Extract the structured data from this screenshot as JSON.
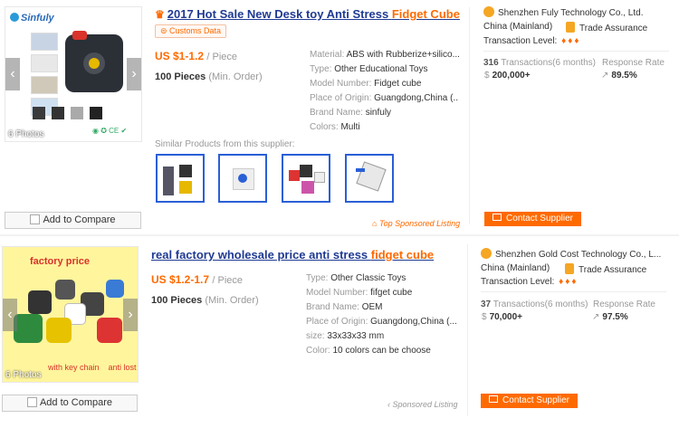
{
  "listings": [
    {
      "image_logo": "Sinfuly",
      "photo_count": "6 Photos",
      "title_prefix": "2017 Hot Sale New Desk toy Anti Stress ",
      "title_highlight": "Fidget Cube",
      "customs_badge": "Customs Data",
      "price": "US $1-1.2",
      "price_unit": "/ Piece",
      "moq": "100 Pieces",
      "moq_sub": "(Min. Order)",
      "attributes": [
        {
          "key": "Material:",
          "value": "ABS with Rubberize+silico..."
        },
        {
          "key": "Type:",
          "value": "Other Educational Toys"
        },
        {
          "key": "Model Number:",
          "value": "Fidget cube"
        },
        {
          "key": "Place of Origin:",
          "value": "Guangdong,China (..."
        },
        {
          "key": "Brand Name:",
          "value": "sinfuly"
        },
        {
          "key": "Colors:",
          "value": "Multi"
        }
      ],
      "similar_label": "Similar Products from this supplier:",
      "compare_label": "Add to Compare",
      "sponsored": "Top Sponsored Listing",
      "supplier_name": "Shenzhen Fuly Technology Co., Ltd.",
      "country": "China (Mainland)",
      "trade_assurance": "Trade Assurance",
      "transaction_level_label": "Transaction Level:",
      "transactions_count": "316",
      "transactions_label": "Transactions(6 months)",
      "transactions_value": "200,000+",
      "response_rate_label": "Response Rate",
      "response_rate": "89.5%",
      "contact_label": "Contact Supplier"
    },
    {
      "image_caption_top": "factory price",
      "image_caption_bottom": "with key chain    anti lost",
      "photo_count": "6 Photos",
      "title_prefix": "real factory wholesale price anti stress ",
      "title_highlight": "fidget cube",
      "price": "US $1.2-1.7",
      "price_unit": "/ Piece",
      "moq": "100 Pieces",
      "moq_sub": "(Min. Order)",
      "attributes": [
        {
          "key": "Type:",
          "value": "Other Classic Toys"
        },
        {
          "key": "Model Number:",
          "value": "fifget cube"
        },
        {
          "key": "Brand Name:",
          "value": "OEM"
        },
        {
          "key": "Place of Origin:",
          "value": "Guangdong,China (..."
        },
        {
          "key": "size:",
          "value": "33x33x33 mm"
        },
        {
          "key": "Color:",
          "value": "10 colors can be choose"
        }
      ],
      "compare_label": "Add to Compare",
      "sponsored": "Sponsored Listing",
      "supplier_name": "Shenzhen Gold Cost Technology Co., L...",
      "country": "China (Mainland)",
      "trade_assurance": "Trade Assurance",
      "transaction_level_label": "Transaction Level:",
      "transactions_count": "37",
      "transactions_label": "Transactions(6 months)",
      "transactions_value": "70,000+",
      "response_rate_label": "Response Rate",
      "response_rate": "97.5%",
      "contact_label": "Contact Supplier"
    }
  ],
  "colors": {
    "accent": "#ff6a00",
    "link": "#1f3a93",
    "thumb_border": "#2a5fd6"
  }
}
